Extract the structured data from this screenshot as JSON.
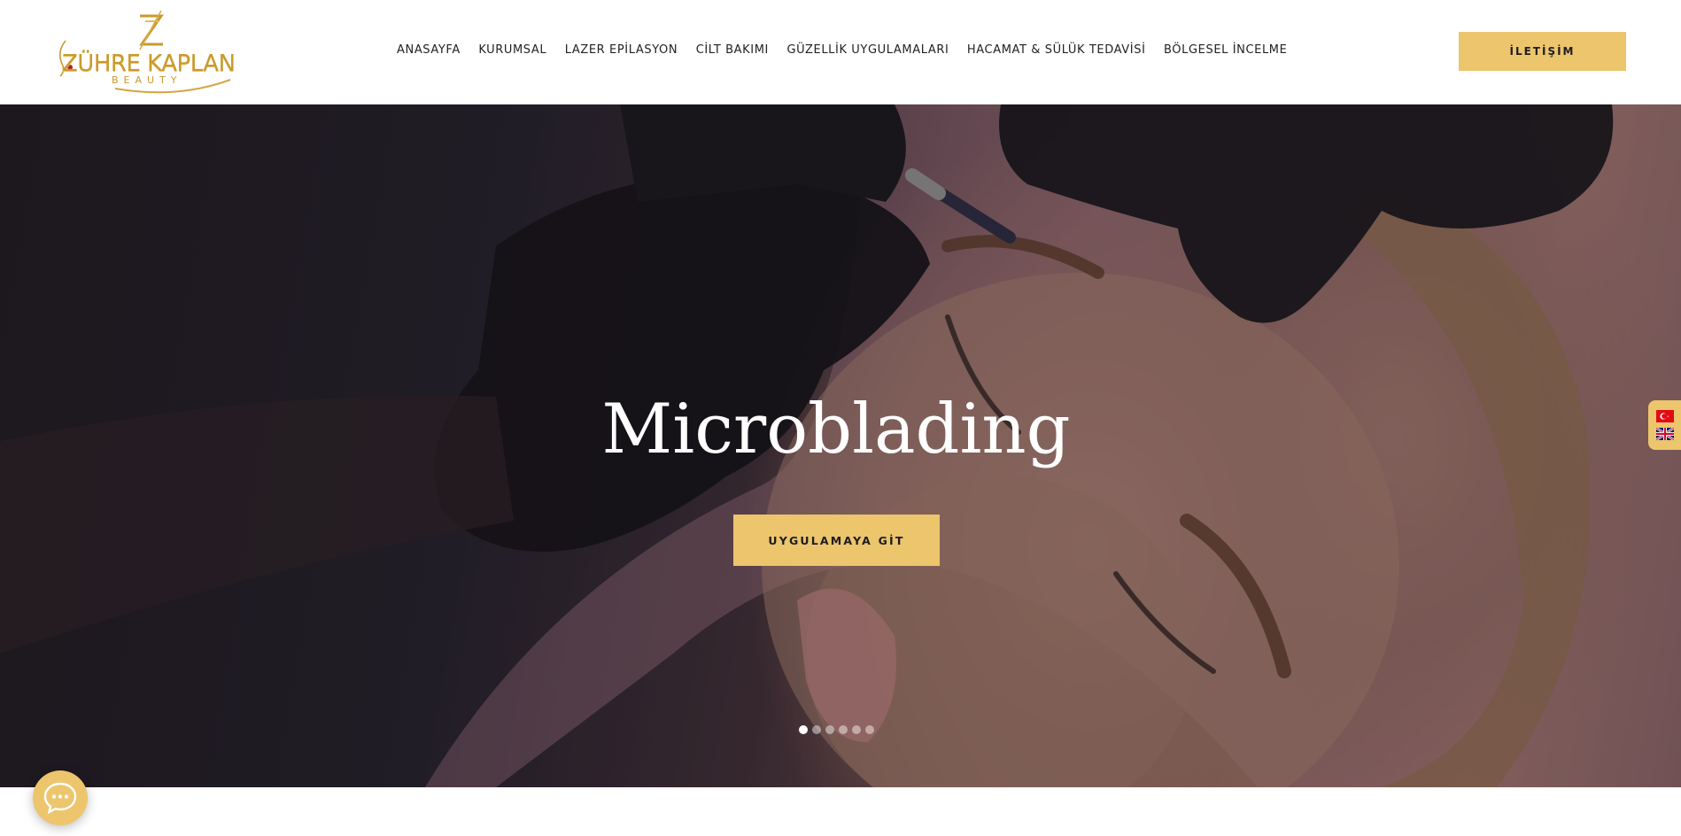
{
  "brand": {
    "name": "ZÜHRE KAPLAN",
    "tagline": "BEAUTY",
    "accent_color": "#ecc56d",
    "logo_color": "#c99a2c"
  },
  "nav": {
    "items": [
      {
        "label": "ANASAYFA"
      },
      {
        "label": "KURUMSAL"
      },
      {
        "label": "LAZER EPİLASYON"
      },
      {
        "label": "CİLT BAKIMI"
      },
      {
        "label": "GÜZELLİK UYGULAMALARI"
      },
      {
        "label": "HACAMAT & SÜLÜK TEDAVİSİ"
      },
      {
        "label": "BÖLGESEL İNCELME"
      }
    ]
  },
  "header": {
    "contact_label": "İLETİŞİM"
  },
  "hero": {
    "title": "Microblading",
    "button_label": "UYGULAMAYA GİT",
    "slide_count": 6,
    "active_slide": 1
  },
  "language_switcher": {
    "options": [
      "tr-flag-icon",
      "uk-flag-icon"
    ]
  },
  "chat": {
    "icon": "chat-bubble-icon"
  }
}
